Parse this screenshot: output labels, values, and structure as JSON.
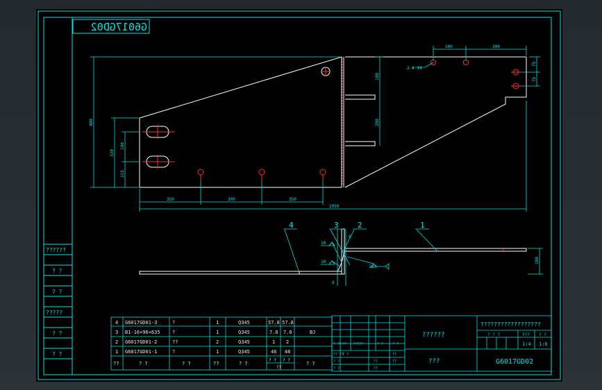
{
  "drawing": {
    "mirrored_code": "G6017GD02",
    "hole_note": "2-Φ 18",
    "dims": {
      "top_left": "100",
      "top_right": "300",
      "right_a": "75",
      "right_b": "75",
      "web_upper": "180",
      "web_lower": "280",
      "height_total": "480",
      "left_upper": "140",
      "left_mid": "330",
      "left_lower": "115",
      "bottom_a": "350",
      "bottom_b": "300",
      "bottom_c": "350",
      "overall_length": "1050",
      "section_height": "180",
      "gap_top": "8",
      "gap_bottom": "8",
      "weld_1": "10",
      "weld_2": "10",
      "weld_3": "10"
    },
    "balloons": [
      "4",
      "3",
      "2",
      "1"
    ]
  },
  "left_column": [
    "??????",
    "? ?",
    "? ?",
    "?????",
    "? ?",
    "? ?"
  ],
  "bom": {
    "rows": [
      {
        "no": "4",
        "code": "G6017GD01-3",
        "name": "?",
        "qty": "1",
        "mat": "Q345",
        "w1": "57.8",
        "w2": "57.8",
        "note": ""
      },
      {
        "no": "3",
        "code": "B1-16×96×635",
        "name": "?",
        "qty": "1",
        "mat": "Q345",
        "w1": "7.6",
        "w2": "7.6",
        "note": "BJ"
      },
      {
        "no": "2",
        "code": "G6017GD01-2",
        "name": "??",
        "qty": "2",
        "mat": "Q345",
        "w1": "1",
        "w2": "2",
        "note": ""
      },
      {
        "no": "1",
        "code": "G6017GD01-1",
        "name": "?",
        "qty": "1",
        "mat": "Q345",
        "w1": "46",
        "w2": "46",
        "note": ""
      }
    ],
    "header": {
      "no": "??",
      "code": "? ?",
      "name": "? ?",
      "qty": "??",
      "mat": "? ?",
      "w1": "? ?",
      "w2": "? ?",
      "w_label": "??",
      "note": "? ?"
    }
  },
  "title_block": {
    "title": "??????????????????",
    "company": "??????",
    "scale_label": "??",
    "scale": "1:4",
    "sheet": "1:6",
    "drawing_no": "G6017GD02",
    "dept": "???",
    "small_labels": [
      "? ??",
      "??",
      "? ?",
      "?????",
      "? ?",
      "? ?",
      "?? ??",
      "? ?",
      "? ?",
      "??",
      "??",
      "??",
      "??"
    ],
    "stage_labels": [
      "? ? ?",
      "? ?",
      "? ?"
    ]
  },
  "colors": {
    "frame": "#00e6e6",
    "geometry": "#ffffff",
    "holes": "#ff3030",
    "text": "#00e6e6",
    "background": "#000000"
  }
}
